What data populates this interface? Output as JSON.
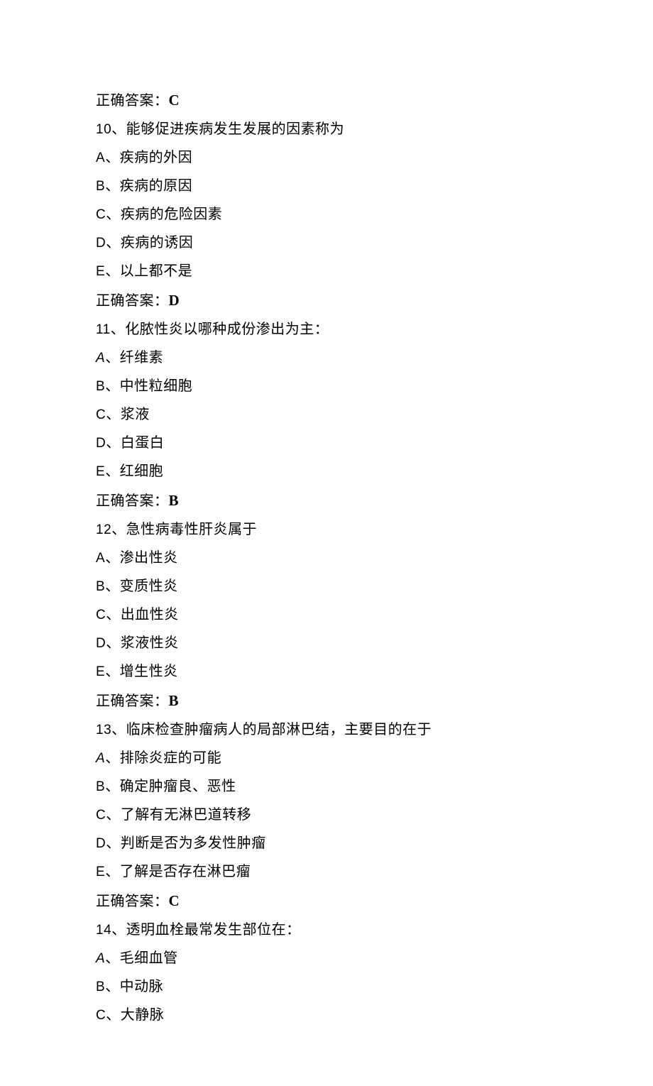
{
  "blocks": [
    {
      "answer_label": "正确答案：",
      "answer_value": "C"
    },
    {
      "question_num": "10",
      "question_text": "、能够促进疾病发生发展的因素称为",
      "options": [
        {
          "letter": "A",
          "text": "、疾病的外因"
        },
        {
          "letter": "B",
          "text": "、疾病的原因"
        },
        {
          "letter": "C",
          "text": "、疾病的危险因素"
        },
        {
          "letter": "D",
          "text": "、疾病的诱因"
        },
        {
          "letter": "E",
          "text": "、以上都不是"
        }
      ],
      "answer_label": "正确答案：",
      "answer_value": "D"
    },
    {
      "question_num": "11",
      "question_text": "、化脓性炎以哪种成份渗出为主：",
      "options": [
        {
          "letter": "A",
          "italic": true,
          "text": "、纤维素"
        },
        {
          "letter": "B",
          "text": "、中性粒细胞"
        },
        {
          "letter": "C",
          "text": "、浆液"
        },
        {
          "letter": "D",
          "text": "、白蛋白"
        },
        {
          "letter": "E",
          "text": "、红细胞"
        }
      ],
      "answer_label": "正确答案：",
      "answer_value": "B"
    },
    {
      "question_num": "12",
      "question_text": "、急性病毒性肝炎属于",
      "options": [
        {
          "letter": "A",
          "text": "、渗出性炎"
        },
        {
          "letter": "B",
          "text": "、变质性炎"
        },
        {
          "letter": "C",
          "text": "、出血性炎"
        },
        {
          "letter": "D",
          "text": "、浆液性炎"
        },
        {
          "letter": "E",
          "text": "、增生性炎"
        }
      ],
      "answer_label": "正确答案：",
      "answer_value": "B"
    },
    {
      "question_num": "13",
      "question_text": "、临床检查肿瘤病人的局部淋巴结，主要目的在于",
      "options": [
        {
          "letter": "A",
          "italic": true,
          "text": "、排除炎症的可能"
        },
        {
          "letter": "B",
          "text": "、确定肿瘤良、恶性"
        },
        {
          "letter": "C",
          "text": "、了解有无淋巴道转移"
        },
        {
          "letter": "D",
          "text": "、判断是否为多发性肿瘤"
        },
        {
          "letter": "E",
          "text": "、了解是否存在淋巴瘤"
        }
      ],
      "answer_label": "正确答案：",
      "answer_value": "C"
    },
    {
      "question_num": "14",
      "question_text": "、透明血栓最常发生部位在：",
      "options": [
        {
          "letter": "A",
          "italic": true,
          "text": "、毛细血管"
        },
        {
          "letter": "B",
          "text": "、中动脉"
        },
        {
          "letter": "C",
          "text": "、大静脉"
        }
      ]
    }
  ]
}
